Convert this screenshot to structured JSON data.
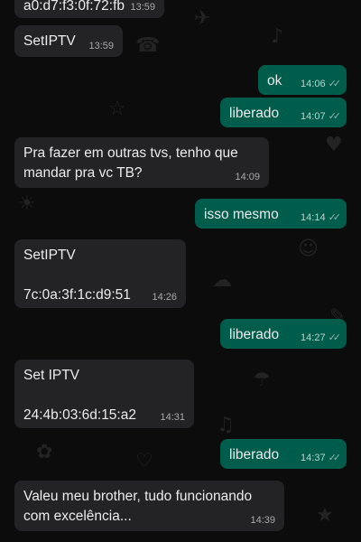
{
  "messages": [
    {
      "dir": "in",
      "text": "a0:d7:f3:0f:72:fb",
      "time": "13:59"
    },
    {
      "dir": "in",
      "text": "SetIPTV",
      "time": "13:59"
    },
    {
      "dir": "out",
      "text": "ok",
      "time": "14:06",
      "ticks": "✓✓"
    },
    {
      "dir": "out",
      "text": "liberado",
      "time": "14:07",
      "ticks": "✓✓"
    },
    {
      "dir": "in",
      "text": "Pra fazer em outras tvs, tenho que mandar pra vc TB?",
      "time": "14:09"
    },
    {
      "dir": "out",
      "text": "isso mesmo",
      "time": "14:14",
      "ticks": "✓✓"
    },
    {
      "dir": "in",
      "text": "SetIPTV\n\n7c:0a:3f:1c:d9:51",
      "time": "14:26"
    },
    {
      "dir": "out",
      "text": "liberado",
      "time": "14:27",
      "ticks": "✓✓"
    },
    {
      "dir": "in",
      "text": "Set IPTV\n\n24:4b:03:6d:15:a2",
      "time": "14:31"
    },
    {
      "dir": "out",
      "text": "liberado",
      "time": "14:37",
      "ticks": "✓✓"
    },
    {
      "dir": "in",
      "text": "Valeu meu brother, tudo funcionando com excelência...",
      "time": "14:39"
    }
  ],
  "colors": {
    "incoming": "#232325",
    "outgoing": "#005c4b",
    "background": "#0c0c0c"
  }
}
